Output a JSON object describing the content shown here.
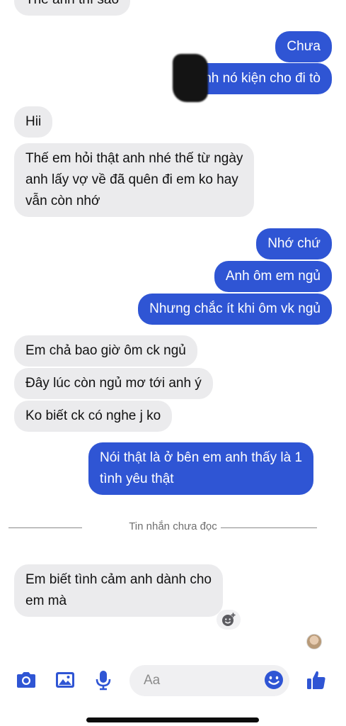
{
  "colors": {
    "outgoing": "#2f55d4",
    "incoming": "#ebebed",
    "accent": "#2f55d4"
  },
  "messages": [
    {
      "dir": "in",
      "text": "Thế anh thì sao"
    },
    {
      "dir": "out",
      "text": "Chưa"
    },
    {
      "dir": "out",
      "text": "Oanh nó kiện cho đi tò"
    },
    {
      "dir": "in",
      "text": "Hii"
    },
    {
      "dir": "in",
      "text": "Thế em hỏi thật anh nhé thế từ ngày\nanh lấy vợ về đã quên đi em ko hay\nvẫn còn nhớ"
    },
    {
      "dir": "out",
      "text": "Nhớ chứ"
    },
    {
      "dir": "out",
      "text": "Anh ôm em ngủ"
    },
    {
      "dir": "out",
      "text": "Nhưng chắc ít khi ôm vk ngủ"
    },
    {
      "dir": "in",
      "text": "Em chả bao giờ ôm ck ngủ"
    },
    {
      "dir": "in",
      "text": "Đây lúc còn ngủ mơ tới anh ý"
    },
    {
      "dir": "in",
      "text": "Ko biết ck có nghe j ko"
    },
    {
      "dir": "out",
      "text": "Nói thật là ở bên em anh thấy là 1\ntình yêu thật"
    },
    {
      "dir": "in",
      "text": "Em biết tình cảm anh dành cho\nem mà"
    }
  ],
  "unread_divider": "Tin nhắn chưa đọc",
  "composer": {
    "placeholder": "Aa",
    "icons": [
      "camera-icon",
      "image-icon",
      "microphone-icon",
      "emoji-icon",
      "thumbs-up-icon"
    ]
  }
}
